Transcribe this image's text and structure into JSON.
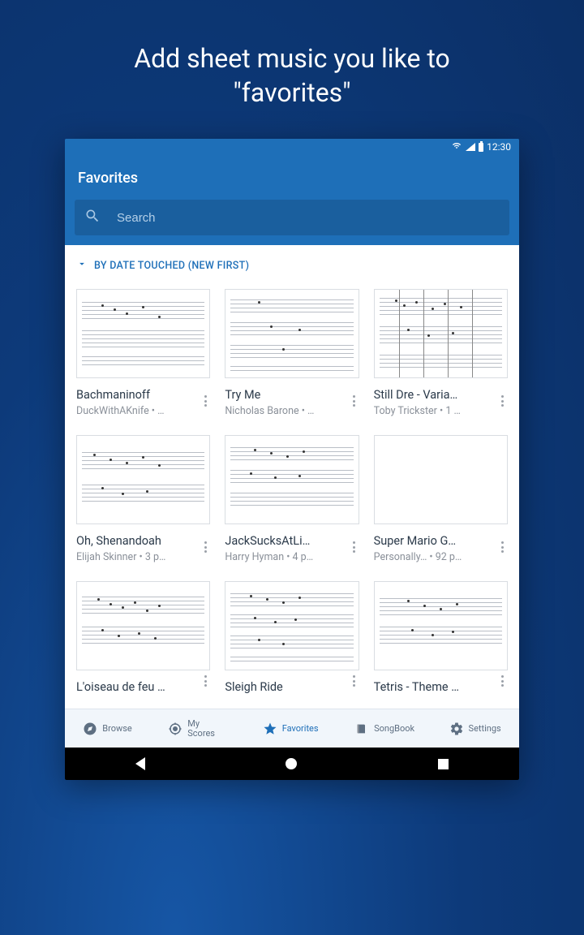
{
  "promo": {
    "line1": "Add sheet music you like to",
    "line2": "\"favorites\""
  },
  "status": {
    "time": "12:30"
  },
  "header": {
    "title": "Favorites"
  },
  "search": {
    "placeholder": "Search"
  },
  "sort": {
    "label": "BY DATE TOUCHED (NEW FIRST)"
  },
  "items": [
    {
      "title": "Bachmaninoff",
      "subtitle": "DuckWithAKnife • …"
    },
    {
      "title": "Try Me",
      "subtitle": "Nicholas Barone • …"
    },
    {
      "title": "Still Dre - Varia…",
      "subtitle": "Toby Trickster • 1 …"
    },
    {
      "title": "Oh, Shenandoah",
      "subtitle": "Elijah Skinner • 3 p…"
    },
    {
      "title": "JackSucksAtLi…",
      "subtitle": "Harry Hyman • 4 p…"
    },
    {
      "title": "Super Mario G…",
      "subtitle": "Personally… • 92 p…"
    },
    {
      "title": "L'oiseau de feu …",
      "subtitle": ""
    },
    {
      "title": "Sleigh Ride",
      "subtitle": ""
    },
    {
      "title": "Tetris - Theme …",
      "subtitle": ""
    }
  ],
  "nav": {
    "browse": "Browse",
    "scores": "My Scores",
    "favorites": "Favorites",
    "songbook": "SongBook",
    "settings": "Settings"
  }
}
